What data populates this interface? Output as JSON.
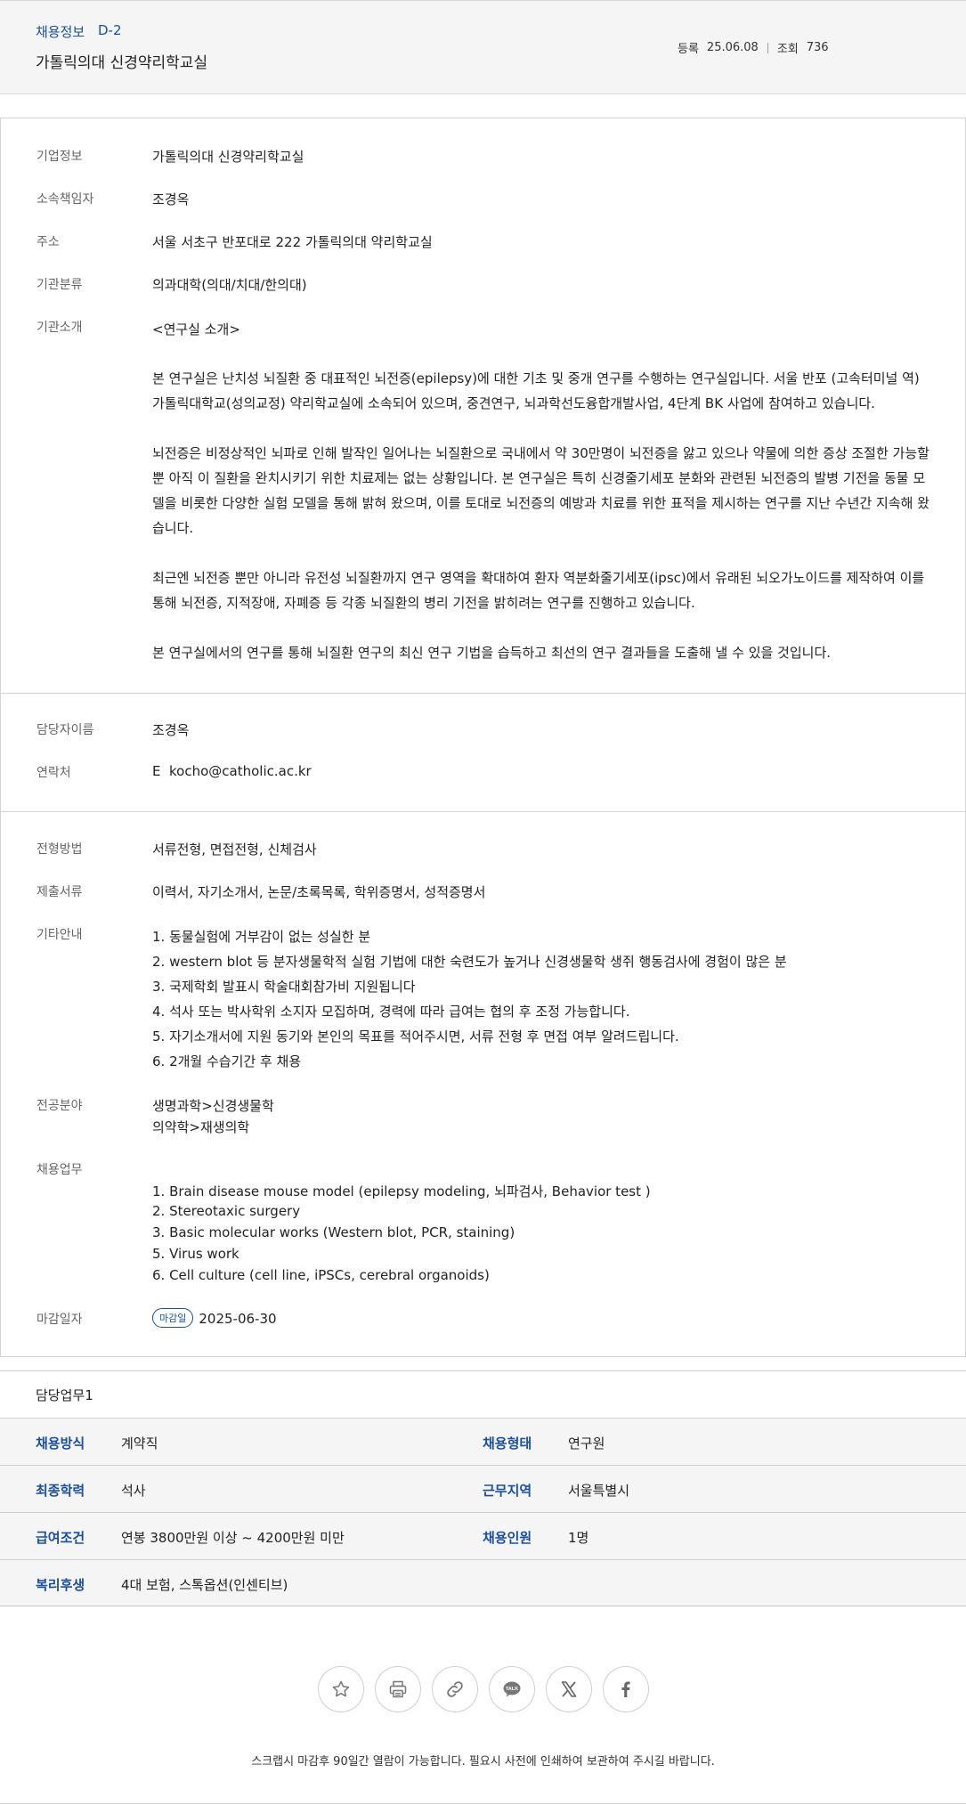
{
  "header": {
    "category": "채용정보",
    "dday": "D-2",
    "title": "가톨릭의대 신경약리학교실",
    "reg_label": "등록",
    "reg_date": "25.06.08",
    "view_label": "조회",
    "view_count": "736"
  },
  "company": {
    "info_label": "기업정보",
    "info_value": "가톨릭의대 신경약리학교실",
    "head_label": "소속책임자",
    "head_value": "조경옥",
    "addr_label": "주소",
    "addr_value": "서울 서초구 반포대로 222 가톨릭의대 약리학교실",
    "class_label": "기관분류",
    "class_value": "의과대학(의대/치대/한의대)",
    "intro_label": "기관소개",
    "intro_heading": "<연구실 소개>",
    "intro_paragraphs": [
      "본 연구실은 난치성 뇌질환 중 대표적인 뇌전증(epilepsy)에 대한 기초 및 중개 연구를 수행하는 연구실입니다. 서울 반포 (고속터미널 역) 가톨릭대학교(성의교정) 약리학교실에 소속되어 있으며, 중견연구, 뇌과학선도융합개발사업, 4단계 BK 사업에 참여하고 있습니다.",
      "뇌전증은 비정상적인 뇌파로 인해 발작인 일어나는 뇌질환으로 국내에서 약 30만명이 뇌전증을 앓고 있으나 약물에 의한 증상 조절한 가능할 뿐 아직 이 질환을 완치시키기 위한 치료제는 없는 상황입니다. 본 연구실은 특히 신경줄기세포 분화와 관련된 뇌전증의 발병 기전을 동물 모델을 비롯한 다양한 실험 모델을 통해 밝혀 왔으며, 이를 토대로 뇌전증의 예방과 치료를 위한 표적을 제시하는 연구를 지난 수년간 지속해 왔습니다.",
      "최근엔 뇌전증 뿐만 아니라 유전성 뇌질환까지 연구 영역을 확대하여 환자 역분화줄기세포(ipsc)에서 유래된 뇌오가노이드를 제작하여 이를 통해 뇌전증, 지적장애, 자폐증 등 각종 뇌질환의 병리 기전을 밝히려는 연구를 진행하고 있습니다.",
      "본 연구실에서의 연구를 통해 뇌질환 연구의 최신 연구 기법을 습득하고 최선의 연구 결과들을 도출해 낼 수 있을 것입니다."
    ]
  },
  "contact": {
    "name_label": "담당자이름",
    "name_value": "조경옥",
    "phone_label": "연락처",
    "email_prefix": "E",
    "email": "kocho@catholic.ac.kr"
  },
  "recruit": {
    "method_label": "전형방법",
    "method_value": "서류전형, 면접전형, 신체검사",
    "docs_label": "제출서류",
    "docs_value": "이력서, 자기소개서, 논문/초록목록, 학위증명서, 성적증명서",
    "etc_label": "기타안내",
    "etc_items": [
      "1. 동물실험에 거부감이 없는 성실한 분",
      "2. western blot 등 분자생물학적 실험 기법에 대한 숙련도가 높거나 신경생물학 생쥐 행동검사에 경험이 많은 분",
      "3. 국제학회 발표시 학술대회참가비 지원됩니다",
      "4. 석사 또는 박사학위 소지자 모집하며, 경력에 따라 급여는 협의 후 조정 가능합니다.",
      "5. 자기소개서에 지원 동기와 본인의 목표를 적어주시면, 서류 전형 후 면접 여부 알려드립니다.",
      "6. 2개월 수습기간 후 채용"
    ],
    "field_label": "전공분야",
    "field_items": [
      "생명과학>신경생물학",
      "의약학>재생의학"
    ],
    "duty_label": "채용업무",
    "duty_items": [
      "1. Brain disease mouse model (epilepsy modeling, 뇌파검사, Behavior test )",
      "2. Stereotaxic surgery",
      "3. Basic molecular works (Western blot, PCR, staining)",
      "5. Virus work",
      "6. Cell culture (cell line, iPSCs, cerebral organoids)"
    ],
    "deadline_label": "마감일자",
    "deadline_badge": "마감일",
    "deadline_value": "2025-06-30"
  },
  "duty_section": {
    "title": "담당업무1",
    "rows": [
      {
        "k1": "채용방식",
        "v1": "계약직",
        "k2": "채용형태",
        "v2": "연구원"
      },
      {
        "k1": "최종학력",
        "v1": "석사",
        "k2": "근무지역",
        "v2": "서울특별시"
      },
      {
        "k1": "급여조건",
        "v1": "연봉 3800만원 이상 ~ 4200만원 미만",
        "k2": "채용인원",
        "v2": "1명"
      },
      {
        "k1": "복리후생",
        "v1": "4대 보험, 스톡옵션(인센티브)",
        "k2": "",
        "v2": ""
      }
    ]
  },
  "share": {
    "icons": [
      "star-icon",
      "print-icon",
      "link-icon",
      "kakaotalk-icon",
      "x-icon",
      "facebook-icon"
    ],
    "talk_text": "TALK"
  },
  "footer": {
    "notice": "스크랩시 마감후 90일간 열람이 가능합니다. 필요시 사전에 인쇄하여 보관하여 주시길 바랍니다."
  },
  "colors": {
    "accent": "#1b4f9c",
    "label": "#666666",
    "panel": "#f5f5f5",
    "border": "#d4d4d4"
  }
}
